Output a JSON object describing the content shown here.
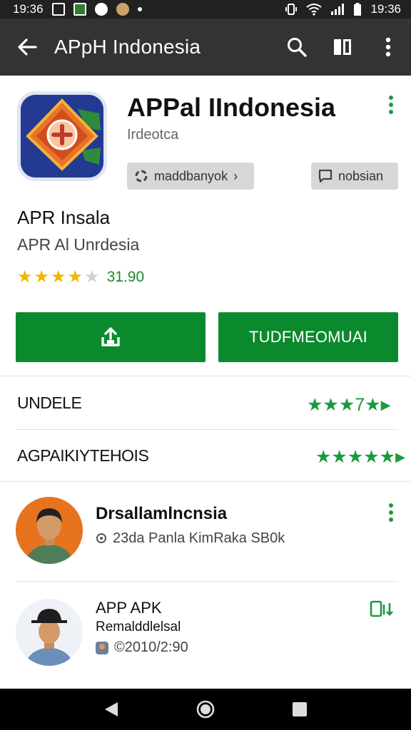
{
  "status_bar": {
    "time_left": "19:36",
    "time_right": "19:36"
  },
  "app_bar": {
    "title": "APpH Indonesia"
  },
  "app": {
    "title": "APPal IIndonesia",
    "developer": "Irdeotca",
    "chip_left": "maddbanyok",
    "chip_left_chevron": "›",
    "chip_right": "nobsian",
    "name": "APR Insala",
    "subtitle": "APR Al Unrdesia",
    "rating": 3.8,
    "rating_label": "31.90",
    "stars": [
      "★",
      "★",
      "★",
      "★",
      "★"
    ]
  },
  "buttons": {
    "open_label": "TUDFMEOMUAI"
  },
  "rows": [
    {
      "label": "UNDELE",
      "stars_text": "★★★7★",
      "arrow": "▶"
    },
    {
      "label": "AGPAIKIYTEHOIS",
      "stars_text": "★★★★★",
      "arrow": "▶"
    }
  ],
  "reviews": [
    {
      "name": "Drsallamlncnsia",
      "meta": "23da Panla KimRaka SB0k"
    },
    {
      "title": "APP APK",
      "body": "Remalddlelsal",
      "meta": "©2010/2:90"
    }
  ],
  "colors": {
    "accent_green": "#0b8a2d",
    "app_bar": "#333333",
    "star_yellow": "#f5b400"
  }
}
